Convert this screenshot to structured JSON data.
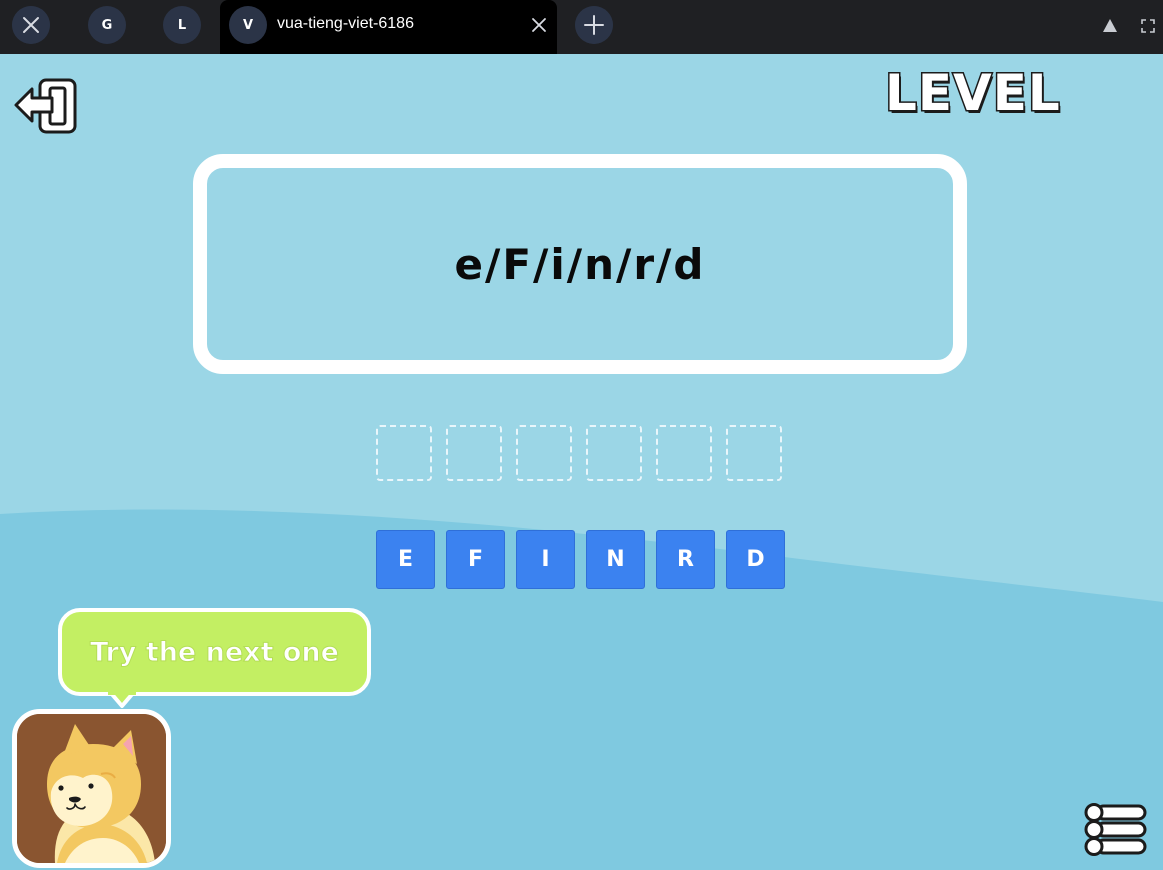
{
  "browser": {
    "tabs": [
      {
        "letter": "G"
      },
      {
        "letter": "L"
      },
      {
        "letter": "V",
        "title": "vua-tieng-viet-6186",
        "active": true
      }
    ]
  },
  "game": {
    "level_label": "LEVEL",
    "scrambled_word": "e/F/i/n/r/d",
    "answer_slots": [
      "",
      "",
      "",
      "",
      "",
      ""
    ],
    "letter_tiles": [
      "E",
      "F",
      "I",
      "N",
      "R",
      "D"
    ],
    "speech_bubble": "Try the next one",
    "mascot": "shiba-inu-dog",
    "colors": {
      "background": "#9bd6e6",
      "background_wave": "#7fc9e0",
      "tile": "#3b82f0",
      "bubble": "#c3ef63",
      "avatar_bg": "#8a5530"
    }
  }
}
